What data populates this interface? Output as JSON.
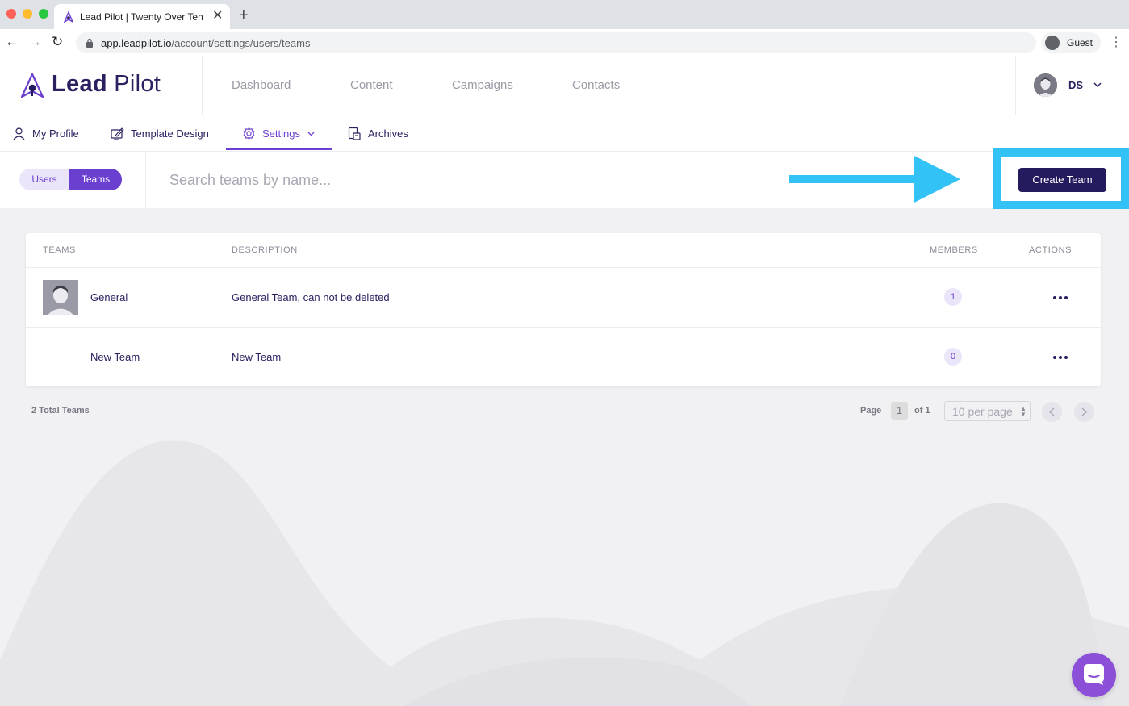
{
  "browser": {
    "tab_title": "Lead Pilot | Twenty Over Ten",
    "tab_close": "✕",
    "new_tab": "+",
    "url_host": "app.leadpilot.io",
    "url_path": "/account/settings/users/teams",
    "profile_label": "Guest",
    "menu_glyph": "⋮",
    "back_glyph": "←",
    "forward_glyph": "→",
    "reload_glyph": "↻"
  },
  "app": {
    "logo_bold": "Lead",
    "logo_light": "Pilot",
    "nav": [
      "Dashboard",
      "Content",
      "Campaigns",
      "Contacts"
    ],
    "user_initials": "DS"
  },
  "subnav": {
    "items": [
      {
        "label": "My Profile",
        "icon": "person-icon"
      },
      {
        "label": "Template Design",
        "icon": "design-icon"
      },
      {
        "label": "Settings",
        "icon": "gear-icon"
      },
      {
        "label": "Archives",
        "icon": "archive-icon"
      }
    ],
    "active": "Settings"
  },
  "toolbar": {
    "toggle_users": "Users",
    "toggle_teams": "Teams",
    "search_placeholder": "Search teams by name...",
    "create_button": "Create Team"
  },
  "table": {
    "headers": [
      "TEAMS",
      "DESCRIPTION",
      "MEMBERS",
      "ACTIONS"
    ],
    "rows": [
      {
        "name": "General",
        "description": "General Team, can not be deleted",
        "members": "1",
        "has_avatar": true
      },
      {
        "name": "New Team",
        "description": "New Team",
        "members": "0",
        "has_avatar": false
      }
    ]
  },
  "footer": {
    "total": "2 Total Teams",
    "page_label": "Page",
    "page_number": "1",
    "of_label": "of 1",
    "per_page": "10 per page"
  },
  "colors": {
    "brand_dark": "#241a5e",
    "brand_purple": "#6b3fcf",
    "annotation_blue": "#33c2f5",
    "chat_purple": "#8b4fd8"
  }
}
